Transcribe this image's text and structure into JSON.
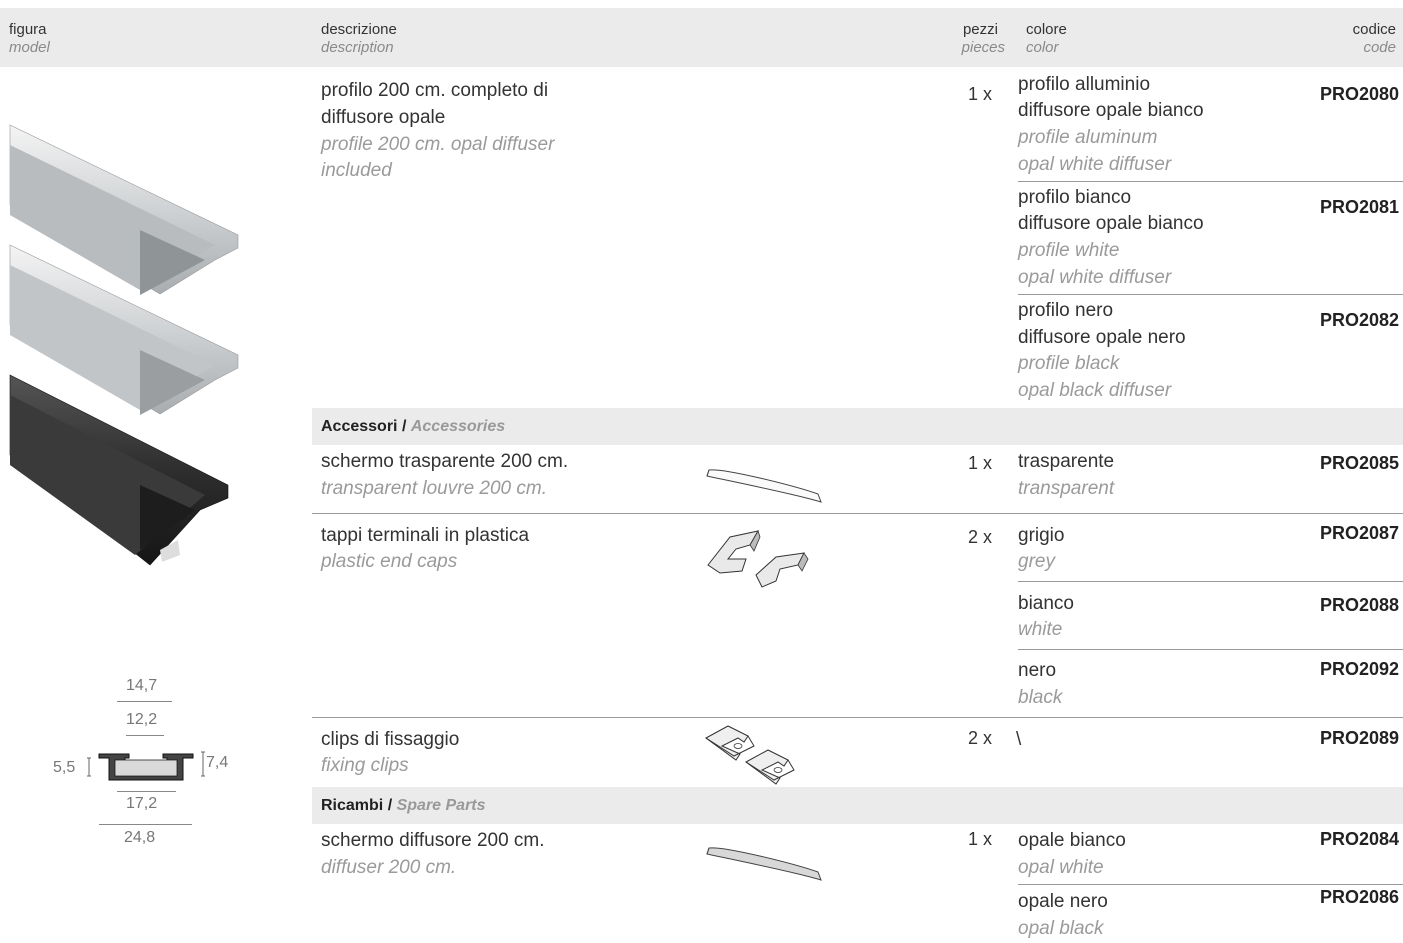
{
  "header": {
    "figura": "figura",
    "model": "model",
    "descrizione": "descrizione",
    "description": "description",
    "pezzi": "pezzi",
    "pieces": "pieces",
    "colore": "colore",
    "color": "color",
    "codice": "codice",
    "code": "code"
  },
  "main_product": {
    "desc_it_1": "profilo 200 cm. completo di",
    "desc_it_2": "diffusore opale",
    "desc_en_1": "profile 200 cm. opal diffuser",
    "desc_en_2": "included",
    "qty": "1 x",
    "variants": [
      {
        "it1": "profilo alluminio",
        "it2": "diffusore opale bianco",
        "en1": "profile aluminum",
        "en2": "opal white diffuser",
        "code": "PRO2080"
      },
      {
        "it1": "profilo bianco",
        "it2": "diffusore opale bianco",
        "en1": "profile white",
        "en2": "opal white diffuser",
        "code": "PRO2081"
      },
      {
        "it1": "profilo nero",
        "it2": "diffusore opale nero",
        "en1": "profile black",
        "en2": "opal black diffuser",
        "code": "PRO2082"
      }
    ]
  },
  "accessories": {
    "title_it": "Accessori /",
    "title_en": "Accessories",
    "items": [
      {
        "it": "schermo trasparente 200 cm.",
        "en": "transparent louvre 200 cm.",
        "qty": "1 x",
        "variants": [
          {
            "it": "trasparente",
            "en": "transparent",
            "code": "PRO2085"
          }
        ]
      },
      {
        "it": "tappi terminali in plastica",
        "en": "plastic end caps",
        "qty": "2 x",
        "variants": [
          {
            "it": "grigio",
            "en": "grey",
            "code": "PRO2087"
          },
          {
            "it": "bianco",
            "en": "white",
            "code": "PRO2088"
          },
          {
            "it": "nero",
            "en": "black",
            "code": "PRO2092"
          }
        ]
      },
      {
        "it": "clips di fissaggio",
        "en": "fixing clips",
        "qty": "2 x",
        "variants": [
          {
            "it": "\\",
            "code": "PRO2089"
          }
        ]
      }
    ]
  },
  "spare_parts": {
    "title_it": "Ricambi /",
    "title_en": "Spare Parts",
    "items": [
      {
        "it": "schermo diffusore 200 cm.",
        "en": "diffuser 200 cm.",
        "qty": "1 x",
        "variants": [
          {
            "it": "opale bianco",
            "en": "opal white",
            "code": "PRO2084"
          },
          {
            "it": "opale nero",
            "en": "opal black",
            "code": "PRO2086"
          }
        ]
      }
    ]
  },
  "dimensions": {
    "top_outer": "14,7",
    "top_inner": "12,2",
    "left_height": "5,5",
    "right_height": "7,4",
    "bottom_inner": "17,2",
    "bottom_outer": "24,8"
  }
}
